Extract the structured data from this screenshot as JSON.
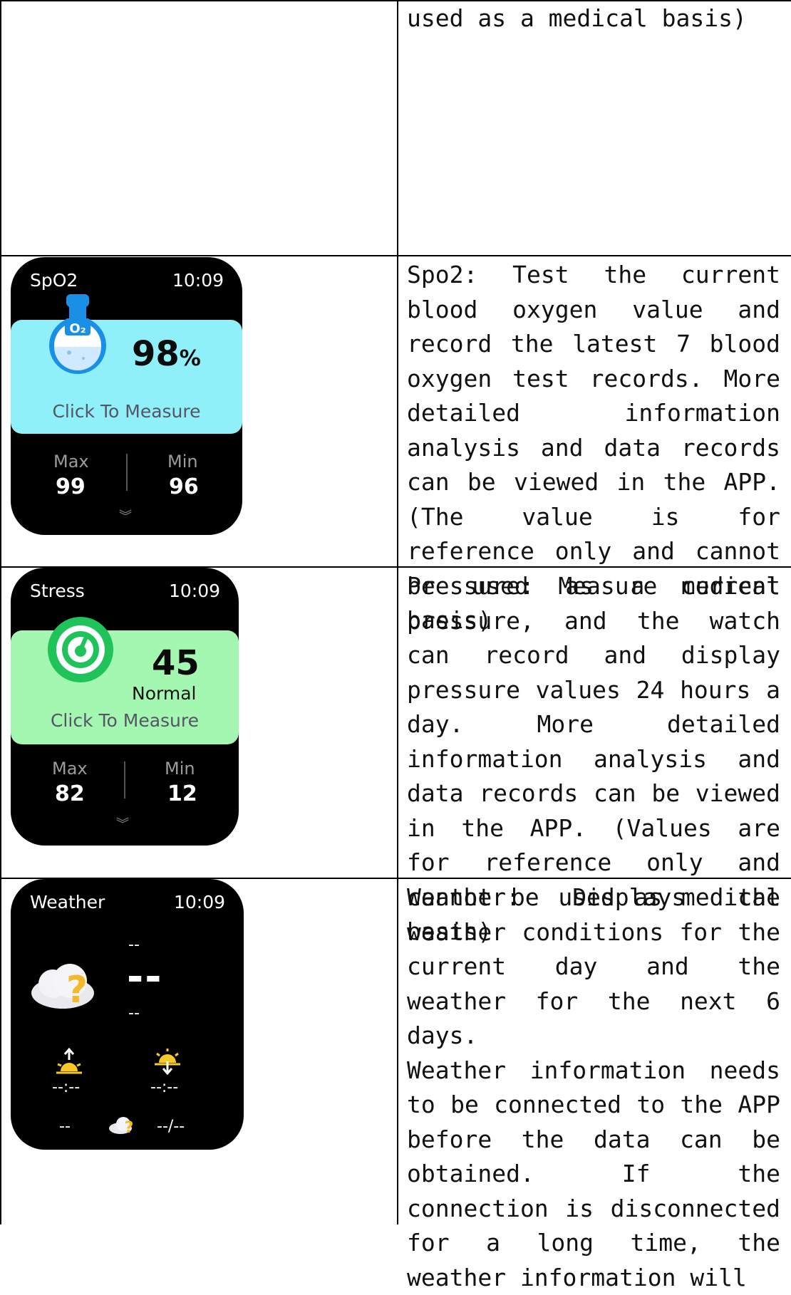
{
  "rows": [
    {
      "description": "used as a medical basis)"
    },
    {
      "description": "Spo2: Test the current blood oxygen value and record the latest 7 blood oxygen test records. More detailed information analysis and data records can be viewed in the APP. (The value is for reference only and cannot be used as a medical basis)",
      "watch": {
        "title": "SpO2",
        "time": "10:09",
        "value": "98",
        "unit": "%",
        "click_label": "Click To Measure",
        "max_label": "Max",
        "max_value": "99",
        "min_label": "Min",
        "min_value": "96",
        "icon": "o2-flask-icon",
        "icon_text": "O₂",
        "panel_color": "#8ff0fa"
      }
    },
    {
      "description": "Pressure: Measure current pressure, and the watch can record and display pressure values 24 hours a day. More detailed information analysis and data records can be viewed in the APP. (Values are for reference only and cannot be used as medical basis)",
      "watch": {
        "title": "Stress",
        "time": "10:09",
        "value": "45",
        "status": "Normal",
        "click_label": "Click To Measure",
        "max_label": "Max",
        "max_value": "82",
        "min_label": "Min",
        "min_value": "12",
        "icon": "stress-gauge-icon",
        "panel_color": "#a3f7b0"
      }
    },
    {
      "description_1": "Weather: Displays the weather conditions for the current day and the weather for the next 6 days.",
      "description_2": "Weather information needs to be connected to the APP before the data can be obtained. If the connection is disconnected for a long time, the weather information will",
      "watch": {
        "title": "Weather",
        "time": "10:09",
        "top_dash": "--",
        "main_dash": "--",
        "bottom_dash": "--",
        "sunrise_time": "--:--",
        "sunset_time": "--:--",
        "footer_left": "--",
        "footer_right": "--/--",
        "icon": "unknown-weather-icon"
      }
    }
  ]
}
